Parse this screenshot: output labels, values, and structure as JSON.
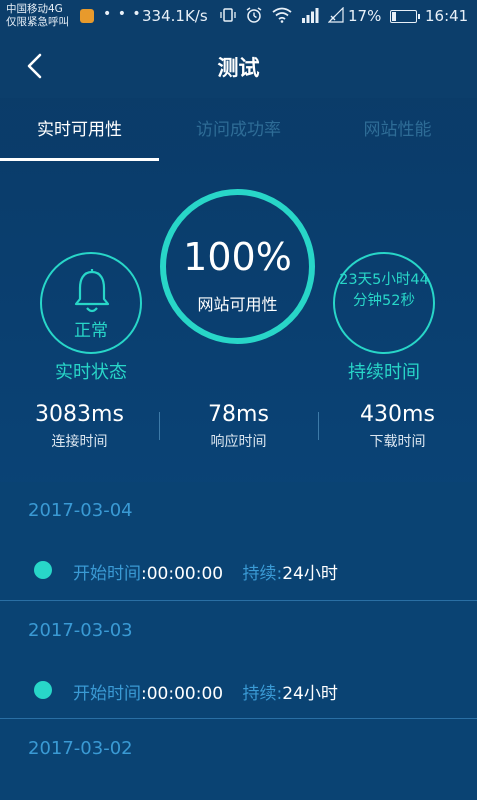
{
  "status_bar": {
    "carrier_line1": "中国移动4G",
    "carrier_line2": "仅限紧急呼叫",
    "dots": "• • •",
    "speed": "334.1K/s",
    "icons": [
      "vibrate-icon",
      "alarm-icon",
      "wifi-icon",
      "signal-icon",
      "signal-x-icon"
    ],
    "battery_pct": "17%",
    "battery_level": 0.17,
    "time": "16:41"
  },
  "header": {
    "title": "测试"
  },
  "tabs": [
    {
      "label": "实时可用性",
      "active": true
    },
    {
      "label": "访问成功率",
      "active": false
    },
    {
      "label": "网站性能",
      "active": false
    }
  ],
  "dashboard": {
    "status_text": "正常",
    "status_label": "实时状态",
    "availability_value": "100%",
    "availability_label": "网站可用性",
    "duration_text": "23天5小时44分钟52秒",
    "duration_label": "持续时间",
    "metrics": [
      {
        "value": "3083ms",
        "label": "连接时间"
      },
      {
        "value": "78ms",
        "label": "响应时间"
      },
      {
        "value": "430ms",
        "label": "下载时间"
      }
    ]
  },
  "history": [
    {
      "date": "2017-03-04",
      "start_key": "开始时间",
      "start_value": "00:00:00",
      "duration_key": "持续",
      "duration_value": "24小时"
    },
    {
      "date": "2017-03-03",
      "start_key": "开始时间",
      "start_value": "00:00:00",
      "duration_key": "持续",
      "duration_value": "24小时"
    },
    {
      "date": "2017-03-02"
    }
  ],
  "colors": {
    "accent": "#28d6c8",
    "key_text": "#3a9ad4",
    "background": "#0b3a66"
  }
}
